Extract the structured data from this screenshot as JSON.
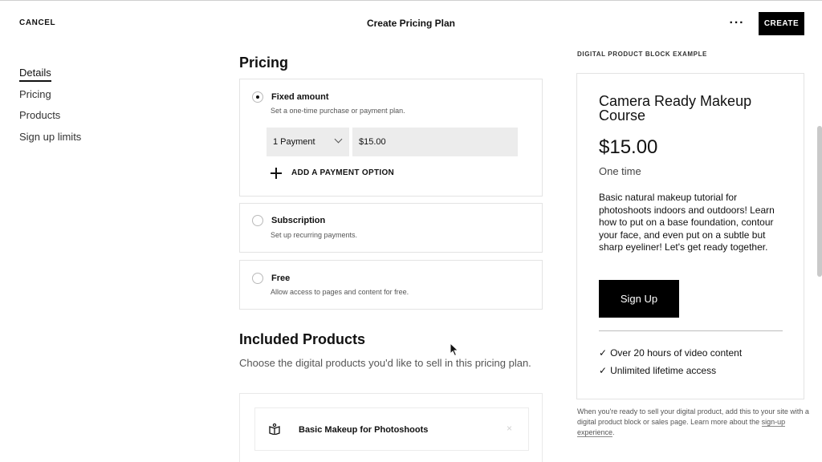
{
  "header": {
    "cancel_label": "CANCEL",
    "title": "Create Pricing Plan",
    "more_label": "···",
    "create_label": "CREATE"
  },
  "nav": {
    "items": [
      {
        "label": "Details",
        "active": true
      },
      {
        "label": "Pricing",
        "active": false
      },
      {
        "label": "Products",
        "active": false
      },
      {
        "label": "Sign up limits",
        "active": false
      }
    ]
  },
  "pricing": {
    "title": "Pricing",
    "options": [
      {
        "title": "Fixed amount",
        "description": "Set a one-time purchase or payment plan.",
        "selected": true
      },
      {
        "title": "Subscription",
        "description": "Set up recurring payments.",
        "selected": false
      },
      {
        "title": "Free",
        "description": "Allow access to pages and content for free.",
        "selected": false
      }
    ],
    "payment_select_value": "1 Payment",
    "price_value": "$15.00",
    "add_option_label": "ADD A PAYMENT OPTION"
  },
  "included": {
    "title": "Included Products",
    "description": "Choose the digital products you'd like to sell in this pricing plan.",
    "products": [
      {
        "name": "Basic Makeup for Photoshoots",
        "icon": "book-icon",
        "remove_glyph": "×"
      }
    ]
  },
  "preview": {
    "heading": "DIGITAL PRODUCT BLOCK EXAMPLE",
    "title": "Camera Ready Makeup Course",
    "price": "$15.00",
    "period": "One time",
    "description": "Basic natural makeup tutorial for photoshoots indoors and outdoors! Learn how to put on a base foundation, contour your face, and even put on a subtle but sharp eyeliner! Let's get ready together.",
    "button_label": "Sign Up",
    "features": [
      "Over 20 hours of video content",
      "Unlimited lifetime access"
    ],
    "check_glyph": "✓"
  },
  "note": {
    "text": "When you're ready to sell your digital product, add this to your site with a digital product block or sales page. Learn more about the ",
    "link_label": "sign-up experience",
    "suffix": "."
  },
  "colors": {
    "accent": "#000000",
    "field_bg": "#ececec",
    "border": "#e3e3e3"
  }
}
